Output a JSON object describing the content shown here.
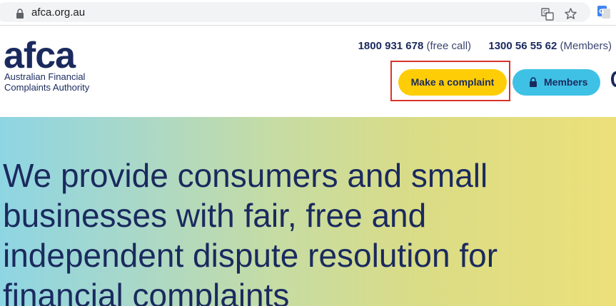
{
  "browser": {
    "url": "afca.org.au"
  },
  "header": {
    "logo_word": "afca",
    "logo_sub_line1": "Australian Financial",
    "logo_sub_line2": "Complaints Authority",
    "phone_free": "1800 931 678",
    "phone_free_note": "(free call)",
    "phone_members": "1300 56 55 62",
    "phone_members_note": "(Members)",
    "complaint_label": "Make a complaint",
    "members_label": "Members"
  },
  "hero": {
    "headline": "We provide consumers and small businesses with fair, free and independent dispute resolution for financial complaints"
  },
  "colors": {
    "navy": "#1a2a5e",
    "yellow": "#ffcd05",
    "cyan": "#3fc1e6",
    "highlight": "#d9342b"
  }
}
